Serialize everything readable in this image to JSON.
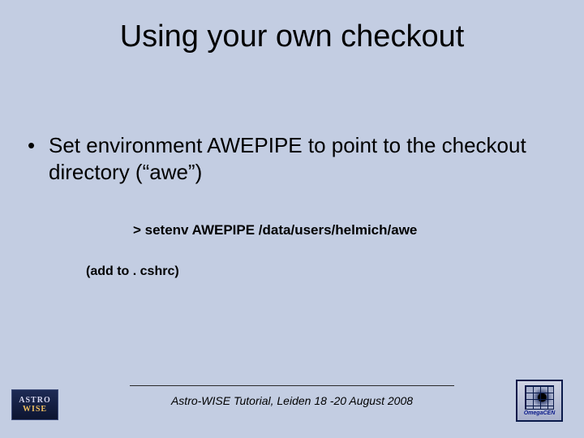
{
  "title": "Using your own checkout",
  "bullet": {
    "marker": "•",
    "text": "Set environment AWEPIPE to point to the checkout directory (“awe”)"
  },
  "command": "> setenv AWEPIPE /data/users/helmich/awe",
  "note": "(add to . cshrc)",
  "footer": "Astro-WISE Tutorial, Leiden 18 -20 August 2008",
  "logo_left": {
    "line1": "ASTRO",
    "line2": "WISE"
  },
  "logo_right": {
    "label": "OmegaCEN"
  }
}
